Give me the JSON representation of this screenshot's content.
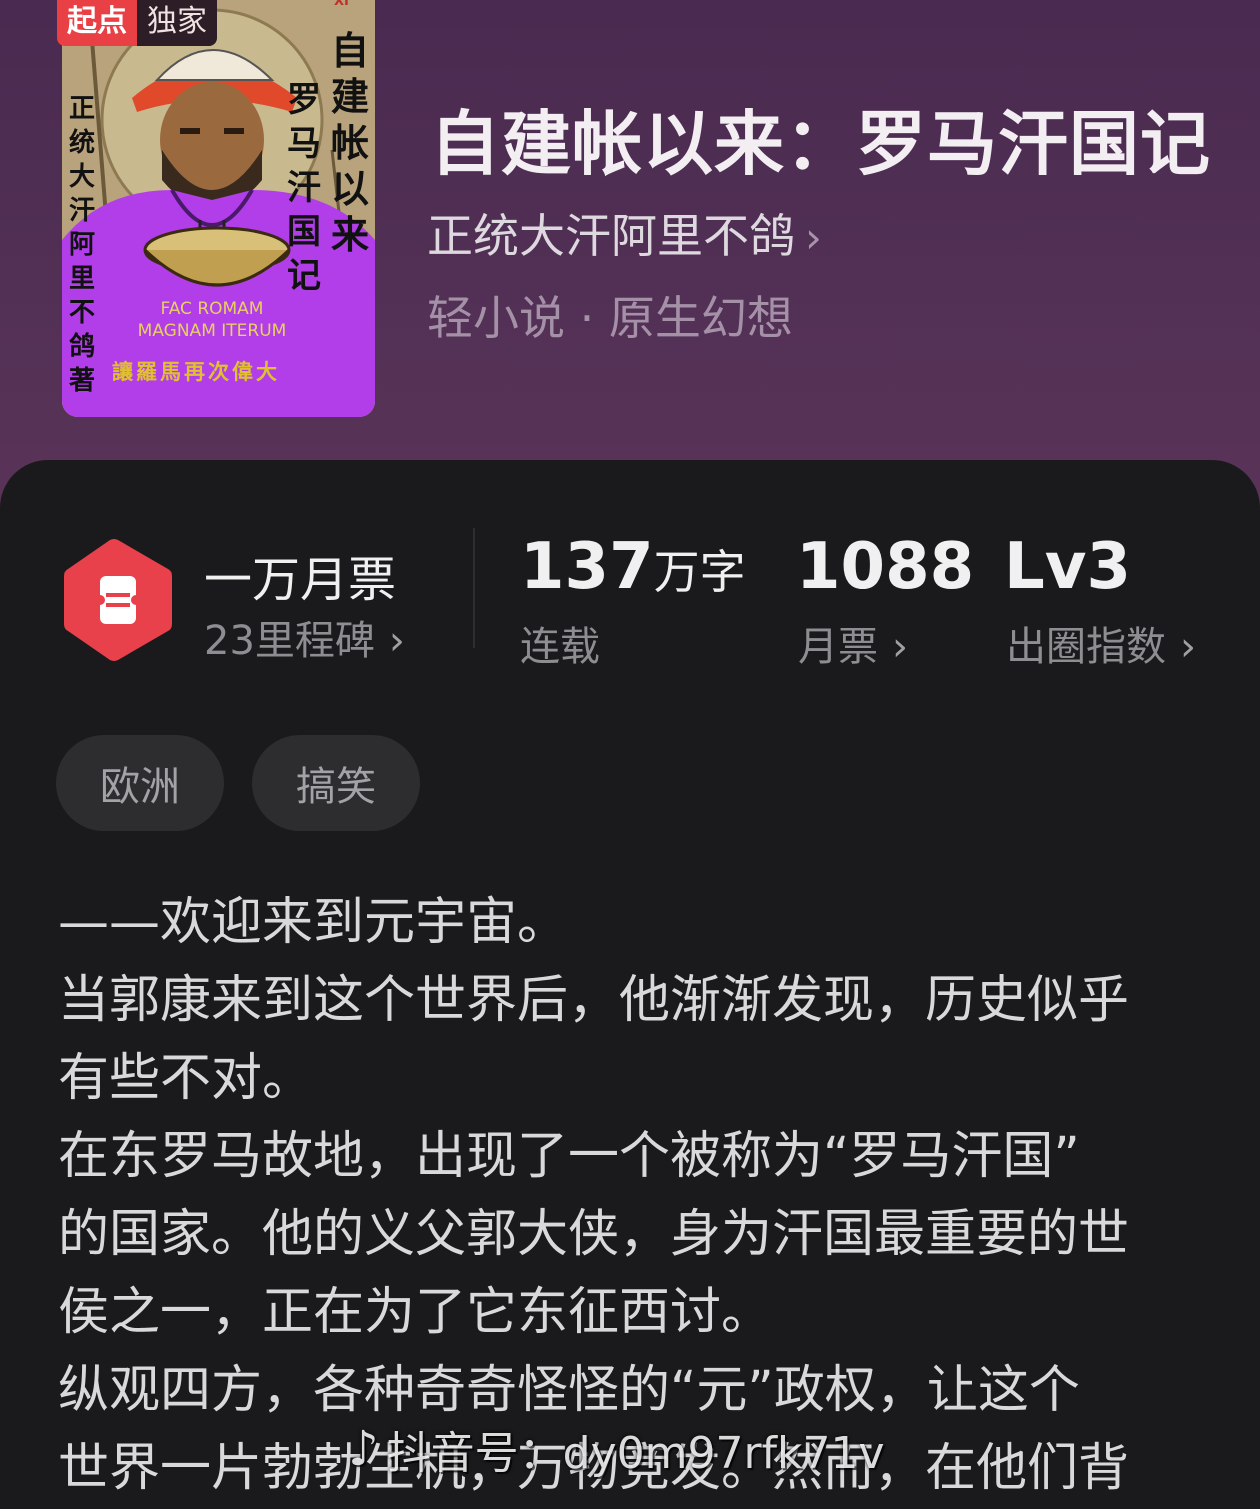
{
  "badge": {
    "brand": "起点",
    "label": "独家"
  },
  "cover": {
    "xi": "XI",
    "title_col1": "自建帐以来",
    "title_col2": "罗马汗国记",
    "author_col": "正统大汗阿里不鸽著",
    "latin_line1": "FAC ROMAM",
    "latin_line2": "MAGNAM ITERUM",
    "motto": "讓羅馬再次偉大"
  },
  "book": {
    "title": "自建帐以来：罗马汗国记",
    "author": "正统大汗阿里不鸽",
    "genre": "轻小说 · 原生幻想"
  },
  "stats": {
    "tickets_title": "一万月票",
    "milestones": "23里程碑",
    "words_number": "137",
    "words_unit": "万字",
    "words_label": "连载",
    "monthly_number": "1088",
    "monthly_label": "月票",
    "level_value": "Lv3",
    "level_label": "出圈指数"
  },
  "tags": [
    "欧洲",
    "搞笑"
  ],
  "synopsis": [
    "——欢迎来到元宇宙。",
    "当郭康来到这个世界后，他渐渐发现，历史似乎",
    "有些不对。",
    "在东罗马故地，出现了一个被称为“罗马汗国”",
    "的国家。他的义父郭大侠，身为汗国最重要的世",
    "侯之一，正在为了它东征西讨。",
    "纵观四方，各种奇奇怪怪的“元”政权，让这个",
    "世界一片勃勃生机，万物竞发。然而，在他们背"
  ],
  "watermark": {
    "icon": "tiktok-icon",
    "text": "抖音号：dy0m97rfk71v"
  },
  "colors": {
    "accent_red": "#e94045",
    "card_bg": "#1a1a1c",
    "header_bg": "#4b2c4f"
  }
}
